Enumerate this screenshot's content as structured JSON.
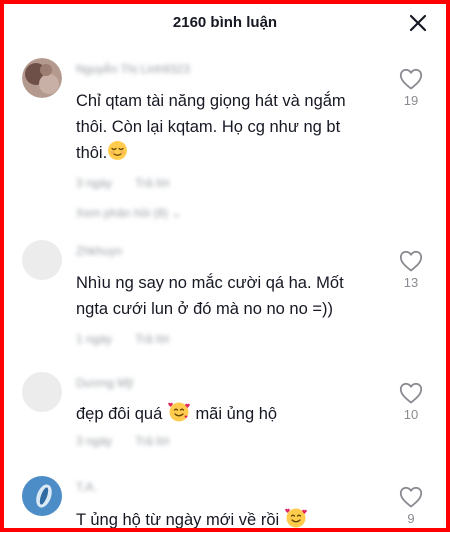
{
  "header": {
    "title": "2160 bình luận"
  },
  "comments": [
    {
      "username": "Nguyễn Thị Linh9323",
      "text_lines": [
        "Chỉ qtam tài năng giọng hát và ngắm",
        "thôi. Còn lại kqtam. Họ cg như ng bt",
        "thôi."
      ],
      "time": "3 ngày",
      "reply_label": "Trả lời",
      "view_replies": "Xem phản hồi (8)",
      "likes": "19",
      "avatar_color": "#8b6f66"
    },
    {
      "username": "Zhkhuyn",
      "text_lines": [
        "Nhìu ng say no mắc cười qá ha. Mốt",
        "ngta cưới lun ở đó mà no no no =))"
      ],
      "time": "1 ngày",
      "reply_label": "Trả lời",
      "likes": "13",
      "avatar_color": "#ececec"
    },
    {
      "username": "Dương Mỹ",
      "text_lines": [
        "đẹp đôi quá",
        "mãi ủng hộ"
      ],
      "time": "3 ngày",
      "reply_label": "Trả lời",
      "likes": "10",
      "avatar_color": "#ececec"
    },
    {
      "username": "T.A.",
      "text_lines": [
        "T ủng hộ từ ngày mới về rồi"
      ],
      "likes": "9",
      "avatar_color": "#3f7fb8"
    }
  ],
  "icons": {
    "close": "close-icon",
    "like": "heart-outline-icon",
    "emoji_relieved": "relieved-face-icon",
    "emoji_hearts": "smiling-face-with-hearts-icon"
  }
}
